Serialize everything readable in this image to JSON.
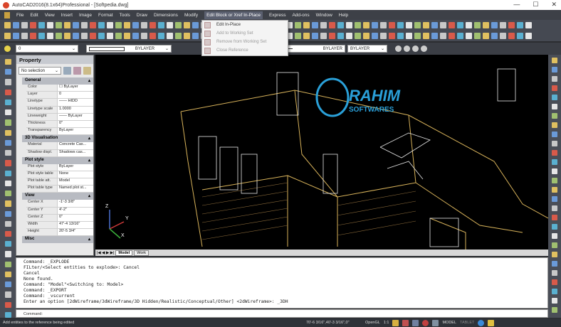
{
  "window": {
    "title": "AutoCAD2016(8.1x64)Professional - [Softpedia.dwg]",
    "min": "—",
    "max": "☐",
    "close": "✕"
  },
  "menu": [
    "File",
    "Edit",
    "View",
    "Insert",
    "Image",
    "Format",
    "Tools",
    "Draw",
    "Dimensions",
    "Modify",
    "Edit Block or Xref In-Place",
    "Express",
    "Add-ons",
    "Window",
    "Help"
  ],
  "dropdown": [
    "Edit In-Place",
    "Add to Working Set",
    "Remove from Working Set",
    "Close Reference"
  ],
  "layer_toolbar": {
    "layer": "0",
    "color": "BYLAYER",
    "linetype": "BYLAYER",
    "lineweight": "BYLAYER"
  },
  "property": {
    "title": "Property",
    "selection": "No selection",
    "sections": [
      {
        "name": "General",
        "rows": [
          [
            "Color",
            "☐ ByLayer"
          ],
          [
            "Layer",
            "0"
          ],
          [
            "Linetype",
            "—— HIDD"
          ],
          [
            "Linetype scale",
            "1.0000"
          ],
          [
            "Lineweight",
            "—— ByLayer"
          ],
          [
            "Thickness",
            "0\""
          ],
          [
            "Transparency",
            "ByLayer"
          ]
        ]
      },
      {
        "name": "3D Visualisation",
        "rows": [
          [
            "Material",
            "Concrete Cas..."
          ],
          [
            "Shadow displ.",
            "Shadows cas..."
          ]
        ]
      },
      {
        "name": "Plot style",
        "rows": [
          [
            "Plot style",
            "ByLayer"
          ],
          [
            "Plot style table",
            "None"
          ],
          [
            "Plot table att.",
            "Model"
          ],
          [
            "Plot table type",
            "Named plot st..."
          ]
        ]
      },
      {
        "name": "View",
        "rows": [
          [
            "Center X",
            "-1'-3 3/8\""
          ],
          [
            "Center Y",
            "4'-2\""
          ],
          [
            "Center Z",
            "0\""
          ],
          [
            "Width",
            "47'-4 13/16\""
          ],
          [
            "Height",
            "20'-5 3/4\""
          ]
        ]
      },
      {
        "name": "Misc",
        "rows": []
      }
    ]
  },
  "watermark": {
    "line1": "RAHIM",
    "line2": "SOFTWARES"
  },
  "ucs": {
    "x": "X",
    "y": "Y",
    "z": "Z"
  },
  "tabs": {
    "nav": "|◀ ◀ ▶ ▶|",
    "model": "Model",
    "work": "Work"
  },
  "command_history": [
    "Command: _EXPLODE",
    "FILter/<Select entities to explode>: Cancel",
    "Cancel",
    "None found.",
    "Command: \"Model\"<Switching to: Model>",
    "Command: _EXPORT",
    "Command: _vscurrent",
    "Enter an option [2dWireframe/3dWireframe/3D Hidden/Realistic/Conceptual/Other] <2dWireframe>: _3DH"
  ],
  "command_prompt": "Command:",
  "status": {
    "message": "Add entities to the reference being edited",
    "coords": "70'-6 3/16\",40'-3 3/16\",0\"",
    "renderer": "OpenGL",
    "scale": "1:1",
    "model": "MODEL",
    "tablet": "TABLET"
  }
}
